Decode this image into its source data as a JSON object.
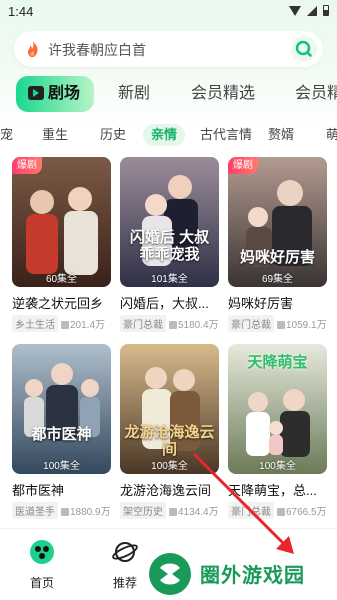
{
  "status": {
    "time": "1:44"
  },
  "search": {
    "placeholder": "许我春朝应白首"
  },
  "tabs": [
    "剧场",
    "新剧",
    "会员精选",
    "会员精"
  ],
  "subcats": [
    "宠",
    "重生",
    "历史",
    "亲情",
    "古代言情",
    "赘婿",
    "萌"
  ],
  "cards": [
    {
      "badge": "爆剧",
      "episodes": "60集全",
      "title": "逆袭之状元回乡",
      "tag": "乡土生活",
      "views": "201.4万",
      "poster_text": "",
      "bg": [
        "#4a2a22",
        "#b07b55"
      ]
    },
    {
      "badge": "",
      "episodes": "101集全",
      "title": "闪婚后，大叔...",
      "tag": "豪门总裁",
      "views": "5180.4万",
      "poster_text": "闪婚后 大叔乖乖宠我",
      "bg": [
        "#2b2f46",
        "#8a7a8c"
      ]
    },
    {
      "badge": "爆剧",
      "episodes": "69集全",
      "title": "妈咪好厉害",
      "tag": "豪门总裁",
      "views": "1059.1万",
      "poster_text": "妈咪好厉害",
      "bg": [
        "#3c3a3a",
        "#a88d82"
      ]
    },
    {
      "badge": "",
      "episodes": "100集全",
      "title": "都市医神",
      "tag": "医道圣手",
      "views": "1880.9万",
      "poster_text": "都市医神",
      "bg": [
        "#3a4e66",
        "#9fb3c2"
      ]
    },
    {
      "badge": "",
      "episodes": "100集全",
      "title": "龙游沧海逸云间",
      "tag": "架空历史",
      "views": "4134.4万",
      "poster_text": "龙游沧海逸云间",
      "bg": [
        "#4d3b2a",
        "#c9a97a"
      ]
    },
    {
      "badge": "",
      "episodes": "100集全",
      "title": "天降萌宝，总...",
      "tag": "豪门总裁",
      "views": "6766.5万",
      "poster_text": "天降萌宝",
      "bg": [
        "#6f7f5c",
        "#d9ddd0"
      ]
    }
  ],
  "nav": {
    "home": "首页",
    "recommend": "推荐"
  },
  "watermark": "圈外游戏园"
}
